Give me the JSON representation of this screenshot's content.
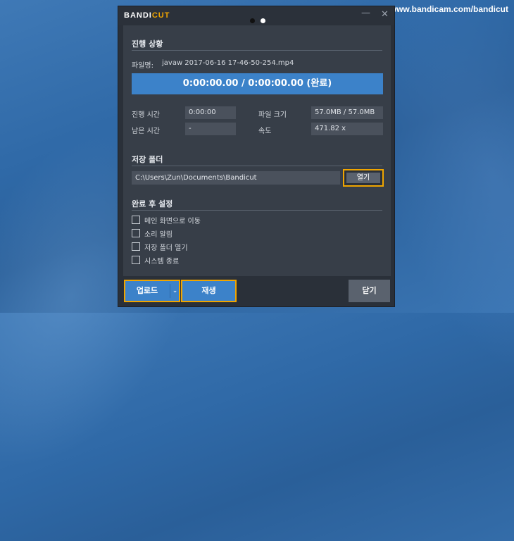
{
  "watermark": "www.bandicam.com/bandicut",
  "app": {
    "logo_main": "BANDI",
    "logo_accent": "CUT"
  },
  "progress_section": {
    "title": "진행 상황",
    "filename_label": "파일명:",
    "filename": "javaw 2017-06-16 17-46-50-254.mp4",
    "bar_text": "0:00:00.00 / 0:00:00.00 (완료)",
    "elapsed_label": "진행 시간",
    "elapsed_value": "0:00:00",
    "remaining_label": "남은 시간",
    "remaining_value": "-",
    "filesize_label": "파일 크기",
    "filesize_value": "57.0MB / 57.0MB",
    "speed_label": "속도",
    "speed_value": "471.82 x"
  },
  "save_folder": {
    "title": "저장 폴더",
    "path": "C:\\Users\\Zun\\Documents\\Bandicut",
    "open_label": "열기"
  },
  "after_settings": {
    "title": "완료 후 설정",
    "options": [
      "메인 화면으로 이동",
      "소리 알림",
      "저장 폴더 열기",
      "시스템 종료"
    ]
  },
  "buttons": {
    "upload": "업로드",
    "play": "재생",
    "close": "닫기"
  },
  "icons": {
    "minimize": "minimize-icon",
    "close": "close-icon",
    "dropdown": "chevron-down-icon"
  },
  "colors": {
    "accent": "#f0a500",
    "primary": "#3c82c9",
    "panel": "#373e48",
    "window": "#2a3039"
  }
}
